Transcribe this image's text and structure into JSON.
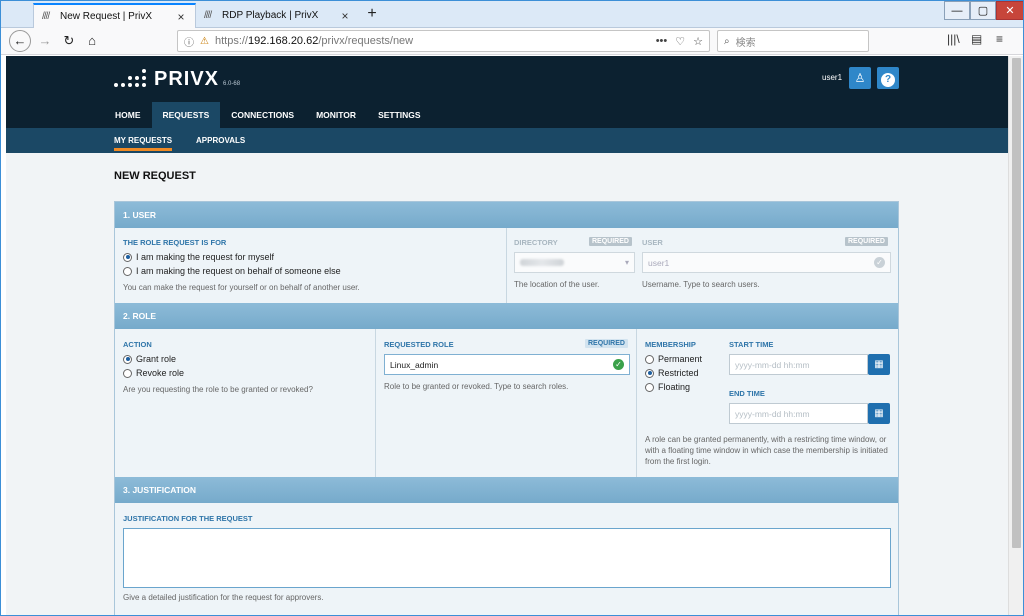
{
  "browser": {
    "tabs": [
      {
        "favicon": "////",
        "title": "New Request | PrivX",
        "close": "×"
      },
      {
        "favicon": "////",
        "title": "RDP Playback | PrivX",
        "close": "×"
      }
    ],
    "new_tab": "+",
    "window_controls": {
      "min": "—",
      "max": "▢",
      "close": "✕"
    },
    "nav": {
      "back": "←",
      "forward": "→",
      "reload": "↻",
      "home": "⌂"
    },
    "url": {
      "scheme": "https://",
      "host": "192.168.20.62",
      "path": "/privx/requests/new"
    },
    "url_actions": [
      "•••",
      "♡",
      "☆"
    ],
    "search_placeholder": "検索",
    "toolbar_right": [
      "|||\\",
      "▤",
      "≡"
    ]
  },
  "app": {
    "logo_text": "PRIVX",
    "version": "6.0-68",
    "user": "user1",
    "help": "?",
    "main_nav": [
      "HOME",
      "REQUESTS",
      "CONNECTIONS",
      "MONITOR",
      "SETTINGS"
    ],
    "sub_nav": [
      "MY REQUESTS",
      "APPROVALS"
    ]
  },
  "page": {
    "title": "NEW REQUEST",
    "sections": {
      "user": {
        "heading": "1. USER",
        "role_request_label": "THE ROLE REQUEST IS FOR",
        "options": [
          "I am making the request for myself",
          "I am making the request on behalf of someone else"
        ],
        "selected_option": 0,
        "help": "You can make the request for yourself or on behalf of another user.",
        "directory_label": "DIRECTORY",
        "directory_required": "REQUIRED",
        "directory_help": "The location of the user.",
        "user_label": "USER",
        "user_required": "REQUIRED",
        "user_value": "user1",
        "user_help": "Username. Type to search users."
      },
      "role": {
        "heading": "2. ROLE",
        "action_label": "ACTION",
        "action_options": [
          "Grant role",
          "Revoke role"
        ],
        "action_selected": 0,
        "action_help": "Are you requesting the role to be granted or revoked?",
        "requested_role_label": "REQUESTED ROLE",
        "requested_role_required": "REQUIRED",
        "requested_role_value": "Linux_admin",
        "requested_role_help": "Role to be granted or revoked. Type to search roles.",
        "membership_label": "MEMBERSHIP",
        "membership_options": [
          "Permanent",
          "Restricted",
          "Floating"
        ],
        "membership_selected": 1,
        "start_time_label": "START TIME",
        "start_time_placeholder": "yyyy-mm-dd hh:mm",
        "end_time_label": "END TIME",
        "end_time_placeholder": "yyyy-mm-dd hh:mm",
        "membership_help": "A role can be granted permanently, with a restricting time window, or with a floating time window in which case the membership is initiated from the first login."
      },
      "justification": {
        "heading": "3. JUSTIFICATION",
        "label": "JUSTIFICATION FOR THE REQUEST",
        "value": "",
        "help": "Give a detailed justification for the request for approvers."
      }
    }
  }
}
